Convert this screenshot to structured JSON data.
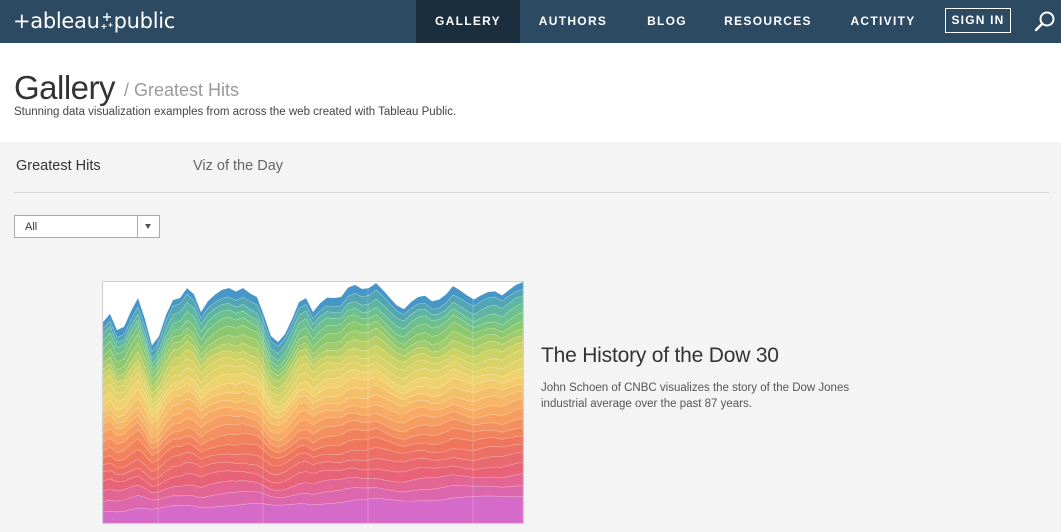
{
  "nav": {
    "logo_left": "+ableau",
    "logo_right": "public",
    "items": [
      {
        "label": "GALLERY",
        "active": true
      },
      {
        "label": "AUTHORS",
        "active": false
      },
      {
        "label": "BLOG",
        "active": false
      },
      {
        "label": "RESOURCES",
        "active": false
      },
      {
        "label": "ACTIVITY",
        "active": false
      }
    ],
    "signin_label": "SIGN IN",
    "search_icon": "search-icon",
    "colors": {
      "bar": "#2d4a63",
      "active": "#1b2e3e"
    }
  },
  "header": {
    "title": "Gallery",
    "crumb": "/ Greatest Hits",
    "description": "Stunning data visualization examples from across the web created with Tableau Public."
  },
  "tabs": [
    {
      "label": "Greatest Hits",
      "active": true
    },
    {
      "label": "Viz of the Day",
      "active": false
    }
  ],
  "filter": {
    "selected": "All",
    "icon": "chevron-down-icon"
  },
  "featured": {
    "title": "The History of the Dow 30",
    "description": "John Schoen of CNBC visualizes the story of the Dow Jones industrial average over the past 87 years."
  }
}
